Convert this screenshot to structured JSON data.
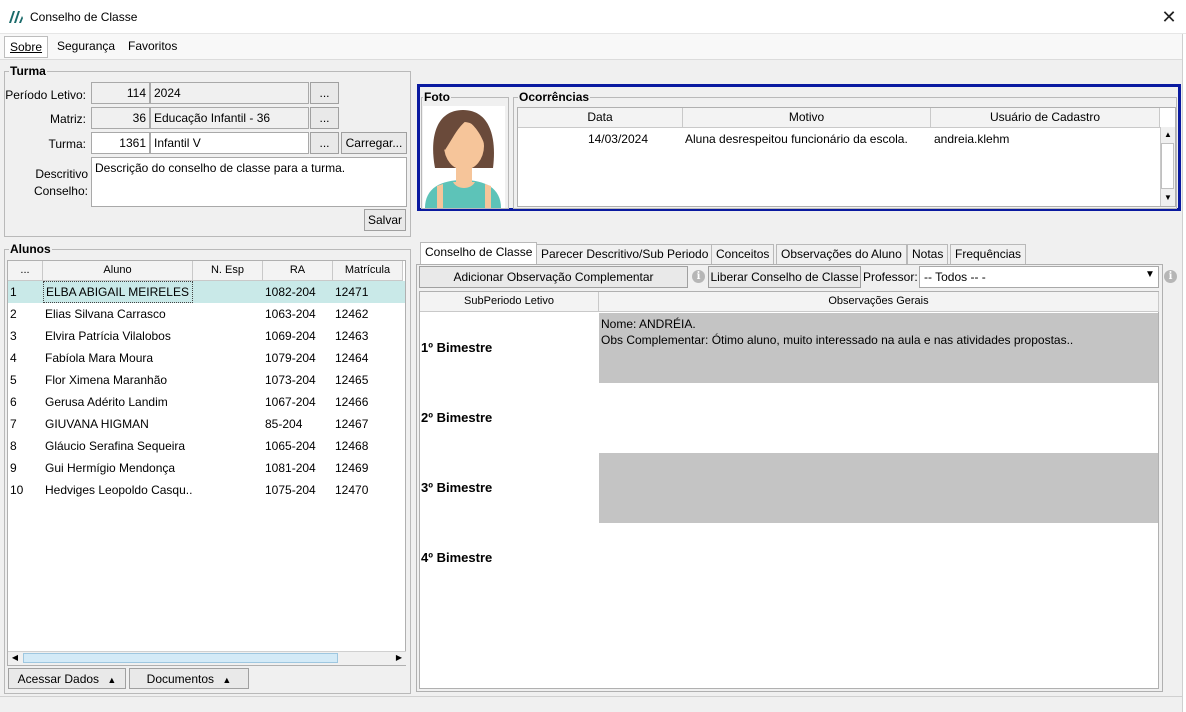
{
  "window": {
    "title": "Conselho de Classe"
  },
  "menu": [
    "Sobre",
    "Segurança",
    "Favoritos"
  ],
  "turma": {
    "title": "Turma",
    "periodo_label": "Período Letivo:",
    "periodo_code": "114",
    "periodo_value": "2024",
    "matriz_label": "Matriz:",
    "matriz_code": "36",
    "matriz_value": "Educação Infantil - 36",
    "turma_label": "Turma:",
    "turma_code": "1361",
    "turma_value": "Infantil V",
    "ellipsis": "...",
    "carregar_label": "Carregar...",
    "descritivo_label_1": "Descritivo",
    "descritivo_label_2": "Conselho:",
    "descritivo_value": "Descrição do conselho de classe para a turma.",
    "salvar_label": "Salvar"
  },
  "alunos": {
    "title": "Alunos",
    "columns": [
      "...",
      "Aluno",
      "N. Esp",
      "RA",
      "Matrícula"
    ],
    "rows": [
      {
        "n": "1",
        "nome": "ELBA ABIGAIL MEIRELES",
        "esp": "",
        "ra": "1082-204",
        "mat": "12471"
      },
      {
        "n": "2",
        "nome": "Elias Silvana Carrasco",
        "esp": "",
        "ra": "1063-204",
        "mat": "12462"
      },
      {
        "n": "3",
        "nome": "Elvira Patrícia Vilalobos",
        "esp": "",
        "ra": "1069-204",
        "mat": "12463"
      },
      {
        "n": "4",
        "nome": "Fabíola Mara Moura",
        "esp": "",
        "ra": "1079-204",
        "mat": "12464"
      },
      {
        "n": "5",
        "nome": "Flor Ximena Maranhão",
        "esp": "",
        "ra": "1073-204",
        "mat": "12465"
      },
      {
        "n": "6",
        "nome": "Gerusa Adérito Landim",
        "esp": "",
        "ra": "1067-204",
        "mat": "12466"
      },
      {
        "n": "7",
        "nome": "GIUVANA HIGMAN",
        "esp": "",
        "ra": "85-204",
        "mat": "12467"
      },
      {
        "n": "8",
        "nome": "Gláucio Serafina Sequeira",
        "esp": "",
        "ra": "1065-204",
        "mat": "12468"
      },
      {
        "n": "9",
        "nome": "Gui Hermígio Mendonça",
        "esp": "",
        "ra": "1081-204",
        "mat": "12469"
      },
      {
        "n": "10",
        "nome": "Hedviges Leopoldo Casqu...",
        "esp": "",
        "ra": "1075-204",
        "mat": "12470"
      }
    ],
    "acessar_label": "Acessar Dados",
    "documentos_label": "Documentos"
  },
  "foto": {
    "title": "Foto"
  },
  "ocorrencias": {
    "title": "Ocorrências",
    "columns": [
      "Data",
      "Motivo",
      "Usuário de Cadastro"
    ],
    "rows": [
      {
        "data": "14/03/2024",
        "motivo": "Aluna desrespeitou funcionário da escola.",
        "usuario": "andreia.klehm"
      }
    ]
  },
  "tabs": [
    "Conselho de Classe",
    "Parecer Descritivo/Sub Periodo",
    "Conceitos",
    "Observações do Aluno",
    "Notas",
    "Frequências"
  ],
  "conselho": {
    "adicionar_label": "Adicionar Observação Complementar",
    "liberar_label": "Liberar Conselho de Classe",
    "professor_label": "Professor:",
    "professor_value": "-- Todos -- -",
    "col_sub": "SubPeriodo Letivo",
    "col_obs": "Observações Gerais",
    "rows": [
      {
        "label": "1º Bimestre",
        "line1": "Nome: ANDRÉIA.",
        "line2": "Obs Complementar: Ótimo aluno, muito interessado na aula e nas atividades propostas.."
      },
      {
        "label": "2º Bimestre",
        "line1": "",
        "line2": ""
      },
      {
        "label": "3º Bimestre",
        "line1": "",
        "line2": ""
      },
      {
        "label": "4º Bimestre",
        "line1": "",
        "line2": ""
      }
    ]
  },
  "colors": {
    "selection": "#c9e9e8",
    "highlight_border": "#0a1aa0",
    "row_gray": "#c4c4c4",
    "avatar_shirt": "#5dc3b8",
    "avatar_hair": "#6a4a3a",
    "avatar_skin": "#f6c59a"
  },
  "icons": [
    "app-logo-icon",
    "close-icon",
    "info-icon",
    "caret-up-icon",
    "chevron-down-icon",
    "scroll-up-icon",
    "scroll-down-icon",
    "scroll-left-icon",
    "scroll-right-icon"
  ]
}
